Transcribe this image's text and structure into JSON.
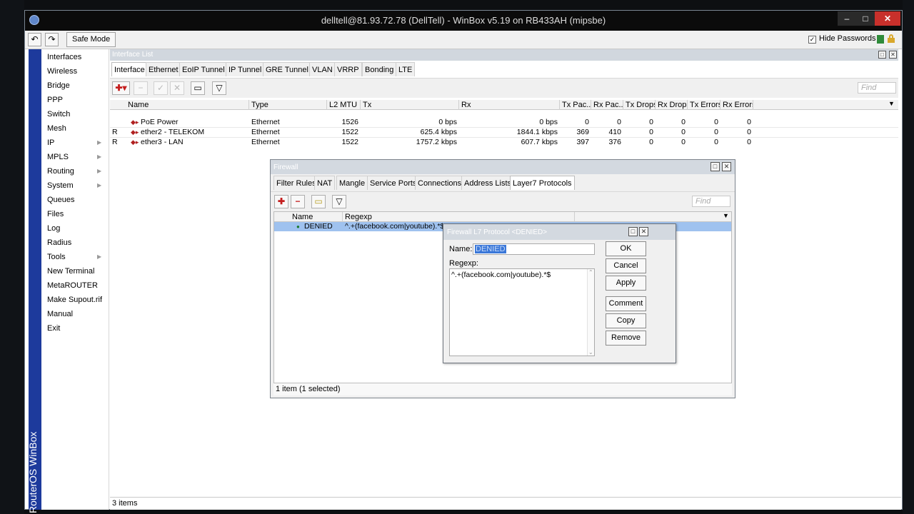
{
  "window": {
    "title": "delltell@81.93.72.78 (DellTell) - WinBox v5.19 on RB433AH (mipsbe)",
    "min_glyph": "–",
    "max_glyph": "□",
    "close_glyph": "✕"
  },
  "toolbar": {
    "undo_glyph": "↶",
    "redo_glyph": "↷",
    "safe_mode_label": "Safe Mode",
    "hide_passwords_label": "Hide Passwords",
    "hide_passwords_checked": "✓"
  },
  "brand": {
    "text": "RouterOS WinBox",
    "color": "#1d3a9c"
  },
  "menu": {
    "items": [
      {
        "label": "Interfaces",
        "arrow": ""
      },
      {
        "label": "Wireless",
        "arrow": ""
      },
      {
        "label": "Bridge",
        "arrow": ""
      },
      {
        "label": "PPP",
        "arrow": ""
      },
      {
        "label": "Switch",
        "arrow": ""
      },
      {
        "label": "Mesh",
        "arrow": ""
      },
      {
        "label": "IP",
        "arrow": "▶"
      },
      {
        "label": "MPLS",
        "arrow": "▶"
      },
      {
        "label": "Routing",
        "arrow": "▶"
      },
      {
        "label": "System",
        "arrow": "▶"
      },
      {
        "label": "Queues",
        "arrow": ""
      },
      {
        "label": "Files",
        "arrow": ""
      },
      {
        "label": "Log",
        "arrow": ""
      },
      {
        "label": "Radius",
        "arrow": ""
      },
      {
        "label": "Tools",
        "arrow": "▶"
      },
      {
        "label": "New Terminal",
        "arrow": ""
      },
      {
        "label": "MetaROUTER",
        "arrow": ""
      },
      {
        "label": "Make Supout.rif",
        "arrow": ""
      },
      {
        "label": "Manual",
        "arrow": ""
      },
      {
        "label": "Exit",
        "arrow": ""
      }
    ]
  },
  "interface_list": {
    "title": "Interface List",
    "tabs": [
      "Interface",
      "Ethernet",
      "EoIP Tunnel",
      "IP Tunnel",
      "GRE Tunnel",
      "VLAN",
      "VRRP",
      "Bonding",
      "LTE"
    ],
    "find_placeholder": "Find",
    "columns": [
      "Name",
      "Type",
      "L2 MTU",
      "Tx",
      "Rx",
      "Tx Pac...",
      "Rx Pac...",
      "Tx Drops",
      "Rx Drops",
      "Tx Errors",
      "Rx Errors"
    ],
    "rows": [
      {
        "flag": "",
        "name": "PoE Power",
        "type": "Ethernet",
        "l2mtu": "1526",
        "tx": "0 bps",
        "rx": "0 bps",
        "txpac": "0",
        "rxpac": "0",
        "txdrops": "0",
        "rxdrops": "0",
        "txerr": "0",
        "rxerr": "0"
      },
      {
        "flag": "R",
        "name": "ether2 - TELEKOM",
        "type": "Ethernet",
        "l2mtu": "1522",
        "tx": "625.4 kbps",
        "rx": "1844.1 kbps",
        "txpac": "369",
        "rxpac": "410",
        "txdrops": "0",
        "rxdrops": "0",
        "txerr": "0",
        "rxerr": "0"
      },
      {
        "flag": "R",
        "name": "ether3 - LAN",
        "type": "Ethernet",
        "l2mtu": "1522",
        "tx": "1757.2 kbps",
        "rx": "607.7 kbps",
        "txpac": "397",
        "rxpac": "376",
        "txdrops": "0",
        "rxdrops": "0",
        "txerr": "0",
        "rxerr": "0"
      }
    ],
    "status": "3 items"
  },
  "firewall": {
    "title": "Firewall",
    "tabs": [
      "Filter Rules",
      "NAT",
      "Mangle",
      "Service Ports",
      "Connections",
      "Address Lists",
      "Layer7 Protocols"
    ],
    "find_placeholder": "Find",
    "columns": [
      "Name",
      "Regexp"
    ],
    "rows": [
      {
        "name": "DENIED",
        "regexp": "^.+(facebook.com|youtube).*$"
      }
    ],
    "status": "1 item (1 selected)"
  },
  "dialog": {
    "title": "Firewall L7 Protocol <DENIED>",
    "name_label": "Name:",
    "name_value": "DENIED",
    "regexp_label": "Regexp:",
    "regexp_value": "^.+(facebook.com|youtube).*$",
    "buttons": [
      "OK",
      "Cancel",
      "Apply",
      "Comment",
      "Copy",
      "Remove"
    ]
  },
  "colors": {
    "accent_red": "#c8302b",
    "selection": "#9fc2ef",
    "add_red": "#c41e1e",
    "folder_yellow": "#e8d43a"
  }
}
